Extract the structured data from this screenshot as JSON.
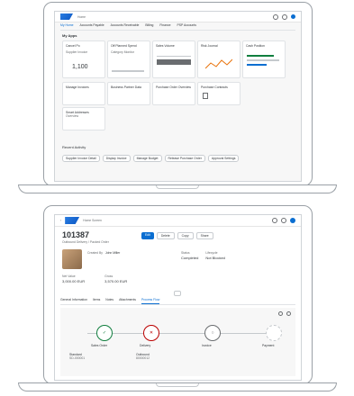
{
  "launchpad": {
    "shell": {
      "nav_tabs": [
        "My Home",
        "Accounts Payable",
        "Accounts Receivable",
        "Billing",
        "Finance",
        "PSP Accounts"
      ]
    },
    "section_title": "My Apps",
    "tiles_row1": [
      {
        "title": "Cancel Po",
        "subtitle": "Supplier Invoice",
        "value": "1,100"
      },
      {
        "title": "Off Planned Spend",
        "subtitle": "Category Monitor",
        "value": ""
      },
      {
        "title": "Sales Volume",
        "subtitle": "",
        "value": ""
      },
      {
        "title": "Risk Journal",
        "subtitle": "",
        "value": ""
      },
      {
        "title": "Cash Position",
        "subtitle": "",
        "value": ""
      }
    ],
    "tiles_row2": [
      {
        "title": "Manage Invoices",
        "subtitle": ""
      },
      {
        "title": "Business Partner Data",
        "subtitle": ""
      },
      {
        "title": "Purchase Order Overview",
        "subtitle": ""
      },
      {
        "title": "Purchase Contracts",
        "subtitle": ""
      }
    ],
    "tiles_row3": [
      {
        "title": "Smart Addresses",
        "subtitle": "Overview"
      }
    ],
    "recent_title": "Recent Activity",
    "recent_chips": [
      "Supplier Invoice Detail",
      "Display Invoice",
      "Manage Budget",
      "Release Purchase Order",
      "Approval Settings"
    ]
  },
  "object_page": {
    "header_title": "Home Screen",
    "object_id": "101387",
    "object_sub": "Outbound Delivery / Packed Order",
    "actions": [
      "Edit",
      "Delete",
      "Copy",
      "Share"
    ],
    "facts": [
      {
        "label": "Created By",
        "value": "John Miller"
      },
      {
        "label": "Status",
        "value": "Completed"
      },
      {
        "label": "Lifecycle",
        "value": "Not Blocked"
      }
    ],
    "amount_label": "Net Value",
    "amount_value": "3,000.00 EUR",
    "amount2_label": "Gross",
    "amount2_value": "3,570.00 EUR",
    "section_tabs": [
      "General Information",
      "Items",
      "Notes",
      "Attachments",
      "Process Flow"
    ],
    "flow_nodes": [
      {
        "label": "Sales Order",
        "status": "ok"
      },
      {
        "label": "Delivery",
        "status": "error"
      },
      {
        "label": "Invoice",
        "status": "neutral"
      },
      {
        "label": "Payment",
        "status": "pending"
      }
    ],
    "flow_docs": [
      {
        "title": "Standard",
        "sub": "SD-000001"
      },
      {
        "title": "Outbound",
        "sub": "80000012"
      }
    ]
  }
}
